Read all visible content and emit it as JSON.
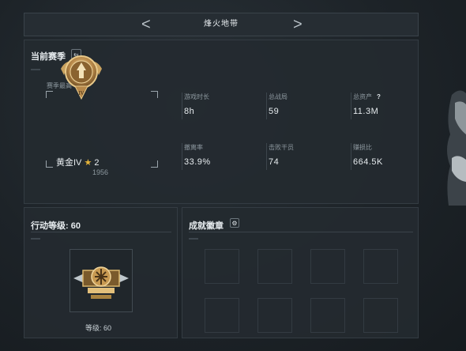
{
  "header": {
    "title": "烽火地带",
    "prev_label": "<",
    "next_label": ">"
  },
  "season": {
    "title": "当前赛季",
    "swap_icon_glyph": "⇆",
    "best_label": "赛季最高",
    "rank": {
      "tier": "黄金IV",
      "star_glyph": "★",
      "stars": "2",
      "points": "1956",
      "emblem_numeral": "IV"
    },
    "stats": [
      {
        "label": "游戏时长",
        "value": "8h"
      },
      {
        "label": "总战局",
        "value": "59"
      },
      {
        "label": "总资产",
        "value": "11.3M",
        "help": "?"
      },
      {
        "label": "撤离率",
        "value": "33.9%"
      },
      {
        "label": "击败干员",
        "value": "74"
      },
      {
        "label": "赚损比",
        "value": "664.5K"
      }
    ]
  },
  "level": {
    "title": "行动等级: 60",
    "level_label": "等级: 60"
  },
  "achievements": {
    "title": "成就徽章",
    "settings_icon_glyph": "⚙"
  },
  "colors": {
    "accent_gold": "#e5b43a",
    "panel_bg": "#242a30"
  }
}
